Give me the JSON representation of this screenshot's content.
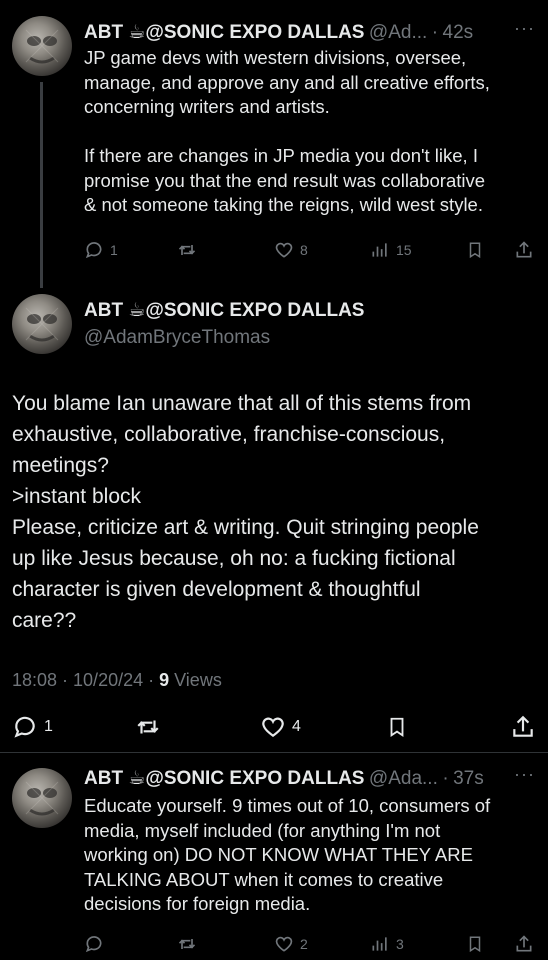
{
  "tweet1": {
    "name": "ABT ☕@SONIC EXPO DALLAS",
    "handle": "@Ad...",
    "sep": "·",
    "time": "42s",
    "more": "···",
    "text": "JP game devs with western divisions, oversee,\nmanage, and approve any and all creative efforts,\nconcerning writers and artists.\n\nIf there are changes in JP media you don't like, I\npromise you that the end result was collaborative\n& not someone taking the reigns, wild west style.",
    "replies": "1",
    "retweets": "",
    "likes": "8",
    "views": "15"
  },
  "main_tweet": {
    "name": "ABT ☕@SONIC EXPO DALLAS",
    "handle": "@AdamBryceThomas",
    "text": "You blame Ian unaware that all of this stems from\nexhaustive, collaborative, franchise-conscious,\nmeetings?\n>instant block\nPlease, criticize art & writing. Quit stringing people\nup like Jesus because, oh no: a fucking fictional\ncharacter is given development & thoughtful\ncare??",
    "timestamp": "18:08 · 10/20/24 · ",
    "views_count": "9",
    "views_label": " Views",
    "replies": "1",
    "likes": "4"
  },
  "tweet3": {
    "name": "ABT ☕@SONIC EXPO DALLAS",
    "handle": "@Ada...",
    "sep": "·",
    "time": "37s",
    "more": "···",
    "text": "Educate yourself. 9 times out of 10, consumers of\nmedia, myself included (for anything I'm not\nworking on) DO NOT KNOW WHAT THEY ARE\nTALKING ABOUT when it comes to creative\ndecisions for foreign media.",
    "replies": "",
    "likes": "2",
    "views": "3"
  },
  "colors": {
    "background": "#000000",
    "text": "#e7e9ea",
    "muted": "#71767b",
    "divider": "#2f3336"
  },
  "icons": [
    "reply-icon",
    "retweet-icon",
    "like-icon",
    "views-icon",
    "bookmark-icon",
    "share-icon",
    "more-icon"
  ]
}
